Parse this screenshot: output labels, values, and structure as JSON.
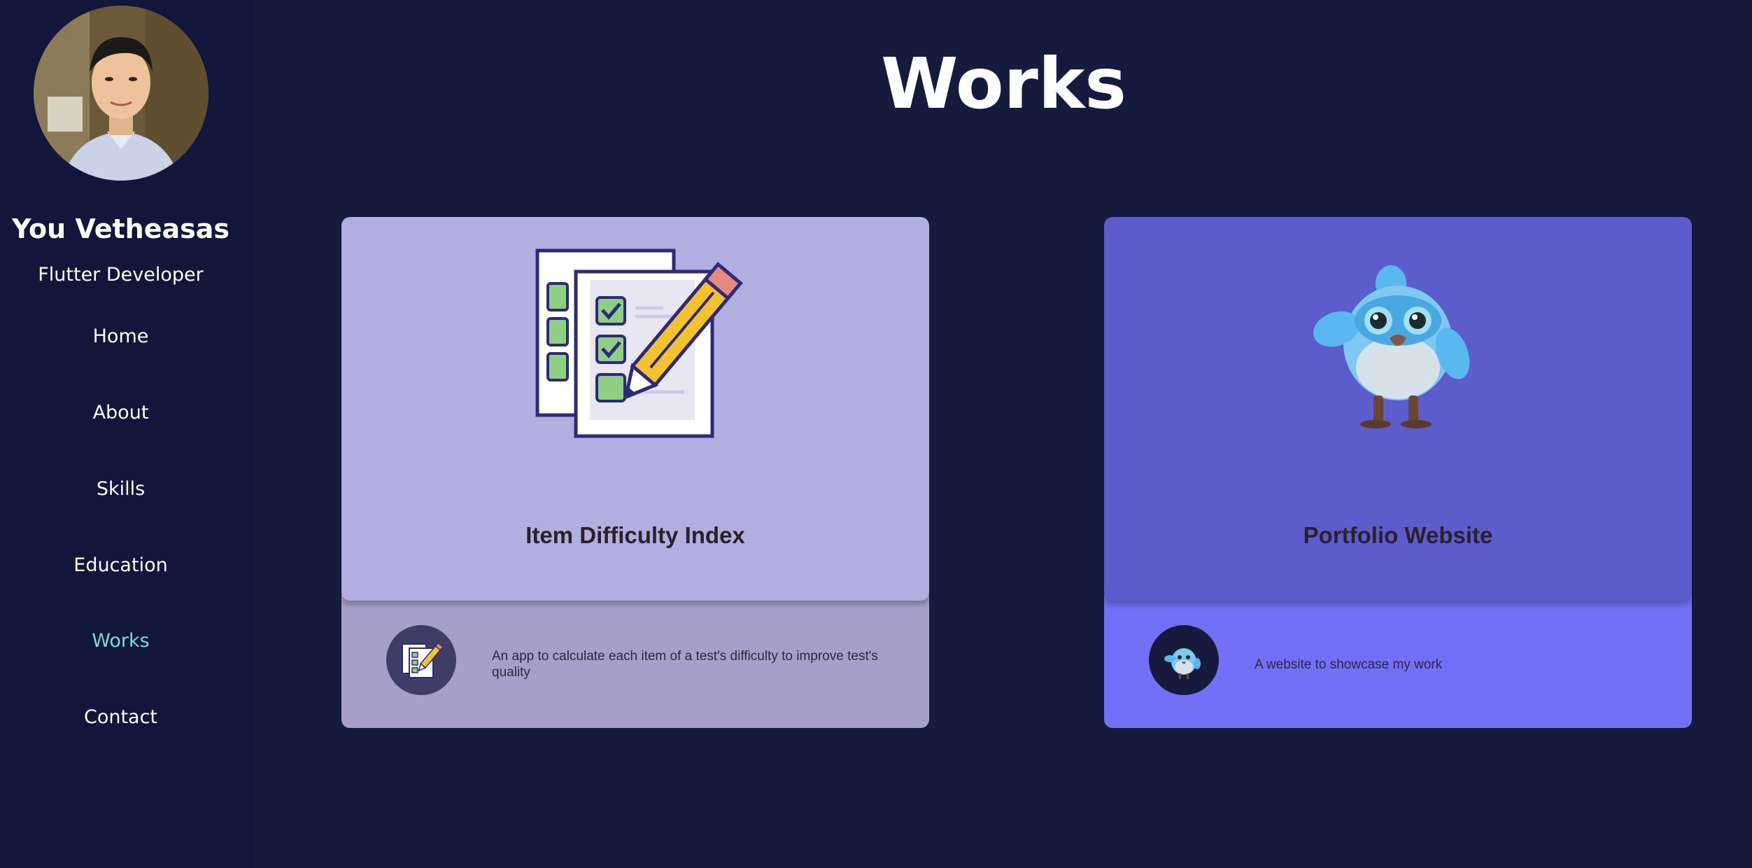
{
  "sidebar": {
    "name": "You Vetheasas",
    "role": "Flutter Developer",
    "nav": [
      {
        "label": "Home",
        "active": false
      },
      {
        "label": "About",
        "active": false
      },
      {
        "label": "Skills",
        "active": false
      },
      {
        "label": "Education",
        "active": false
      },
      {
        "label": "Works",
        "active": true
      },
      {
        "label": "Contact",
        "active": false
      }
    ]
  },
  "main": {
    "title": "Works",
    "projects": [
      {
        "title": "Item Difficulty Index",
        "description": "An app to calculate each item of a test's difficulty to improve test's quality",
        "icon": "checklist-pencil-icon"
      },
      {
        "title": "Portfolio Website",
        "description": "A website to showcase my work",
        "icon": "blue-bird-icon"
      }
    ]
  },
  "colors": {
    "background": "#141b3c",
    "sidebar": "#12163a",
    "active_nav": "#7fd8d8",
    "card1_top": "#b3aee0",
    "card1_bottom": "#a59fca",
    "card2_top": "#5c5ccc",
    "card2_bottom": "#7270f7"
  }
}
